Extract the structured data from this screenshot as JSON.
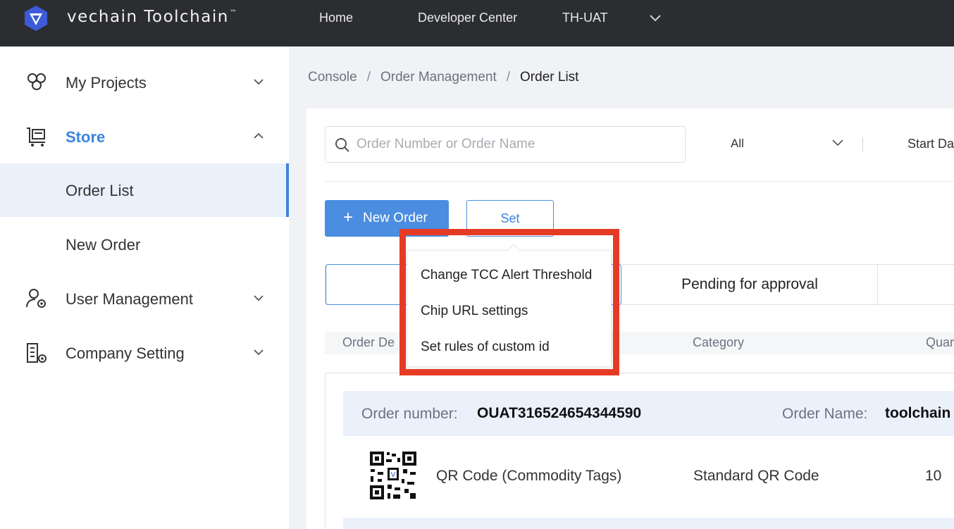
{
  "header": {
    "brand": "vechain Toolchain",
    "brand_mark": "™",
    "nav": [
      "Home",
      "Developer Center",
      "TH-UAT"
    ]
  },
  "sidebar": {
    "items": [
      {
        "label": "My Projects",
        "icon": "projects-icon"
      },
      {
        "label": "Store",
        "icon": "store-cart-icon"
      },
      {
        "label": "Order List"
      },
      {
        "label": "New Order"
      },
      {
        "label": "User Management",
        "icon": "user-gear-icon"
      },
      {
        "label": "Company Setting",
        "icon": "building-gear-icon"
      }
    ],
    "accent": "#3a84df"
  },
  "breadcrumb": {
    "items": [
      "Console",
      "Order Management",
      "Order List"
    ],
    "separator": "/"
  },
  "filters": {
    "search_placeholder": "Order Number or Order Name",
    "status_select": "All",
    "start_date": "Start Da"
  },
  "toolbar": {
    "new_order": "New Order",
    "set": "Set"
  },
  "set_menu": {
    "items": [
      "Change TCC Alert Threshold",
      "Chip URL settings",
      "Set rules of custom id"
    ]
  },
  "tabs": {
    "pending": "Pending for approval"
  },
  "table": {
    "headers": [
      "Order De",
      "Category",
      "Quar"
    ]
  },
  "order": {
    "number_label": "Order number:",
    "number": "OUAT316524654344590",
    "name_label": "Order Name:",
    "name": "toolchain",
    "product": "QR Code (Commodity Tags)",
    "category": "Standard QR Code",
    "quantity": "10"
  }
}
